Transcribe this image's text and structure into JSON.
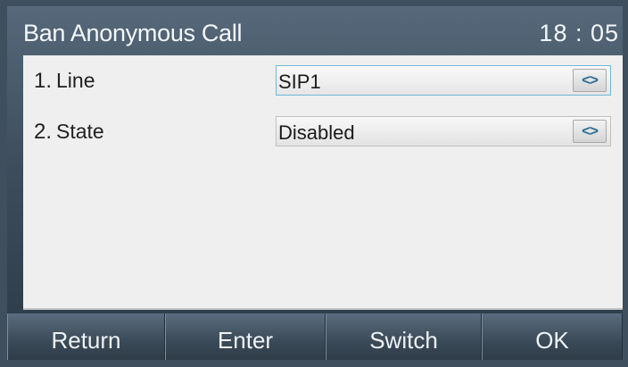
{
  "title_bar": {
    "title": "Ban Anonymous Call",
    "time": "18 : 05"
  },
  "settings": [
    {
      "number": "1.",
      "label": "Line",
      "value": "SIP1",
      "focused": true
    },
    {
      "number": "2.",
      "label": "State",
      "value": "Disabled",
      "focused": false
    }
  ],
  "switch_glyph": "<>",
  "softkeys": {
    "return_label": "Return",
    "enter_label": "Enter",
    "switch_label": "Switch",
    "ok_label": "OK"
  },
  "colors": {
    "accent": "#2a6f95",
    "focus_border": "#6fb8d8",
    "panel": "#efefef"
  }
}
